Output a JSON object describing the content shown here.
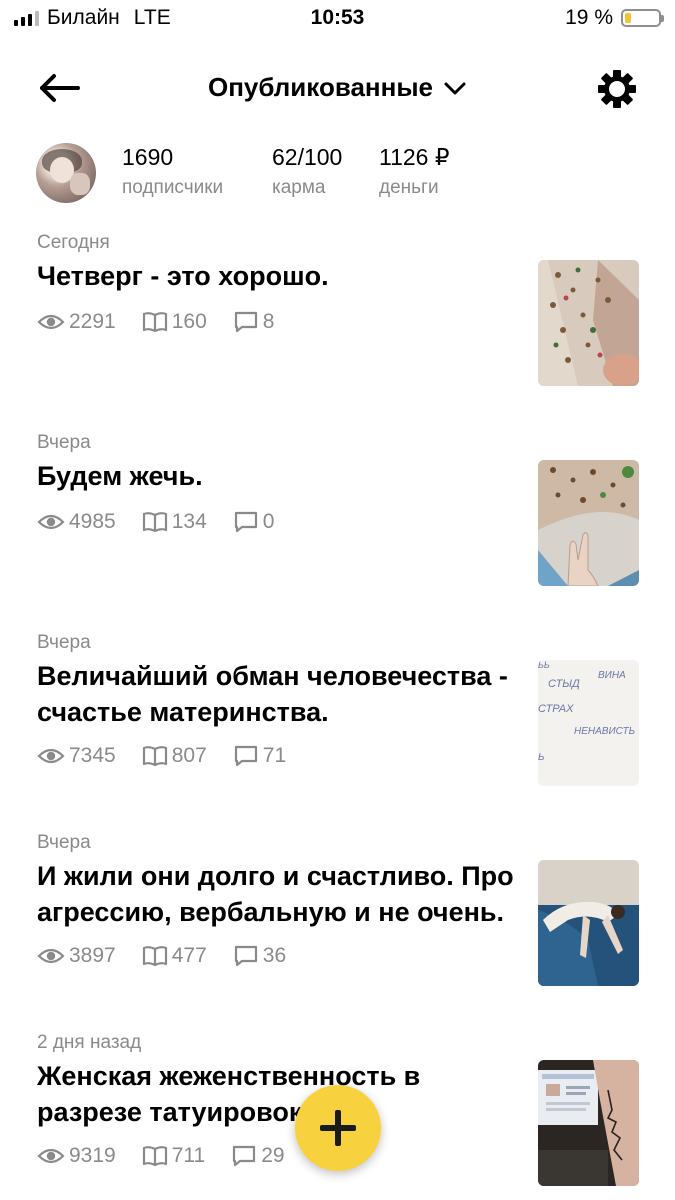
{
  "status_bar": {
    "carrier": "Билайн",
    "network": "LTE",
    "time": "10:53",
    "battery_percent": "19 %",
    "battery_level": 0.19,
    "battery_color": "#f4c430"
  },
  "header": {
    "back_icon": "arrow-left-icon",
    "title": "Опубликованные",
    "title_icon": "chevron-down-icon",
    "settings_icon": "gear-icon"
  },
  "profile": {
    "subscribers": {
      "value": "1690",
      "label": "подписчики"
    },
    "karma": {
      "value": "62/100",
      "label": "карма"
    },
    "money": {
      "value": "1126 ₽",
      "label": "деньги"
    }
  },
  "articles": [
    {
      "date": "Сегодня",
      "title": "Четверг - это хорошо.",
      "views": "2291",
      "reads": "160",
      "comments": "8"
    },
    {
      "date": "Вчера",
      "title": "Будем жечь.",
      "views": "4985",
      "reads": "134",
      "comments": "0"
    },
    {
      "date": "Вчера",
      "title": "Величайший обман человечества - счастье материнства.",
      "views": "7345",
      "reads": "807",
      "comments": "71"
    },
    {
      "date": "Вчера",
      "title": "И жили они долго и счастливо. Про агрессию, вербальную и не очень.",
      "views": "3897",
      "reads": "477",
      "comments": "36"
    },
    {
      "date": "2 дня назад",
      "title": "Женская жеженственность в разрезе татуировок",
      "views": "9319",
      "reads": "711",
      "comments": "29"
    }
  ],
  "thumb3": {
    "words": [
      "СТЫД",
      "ВИНА",
      "СТРАХ",
      "НЕНАВИСТЬ",
      "ЬЬ",
      "Ь"
    ]
  },
  "fab": {
    "icon": "plus-icon",
    "color": "#f7d23e"
  }
}
